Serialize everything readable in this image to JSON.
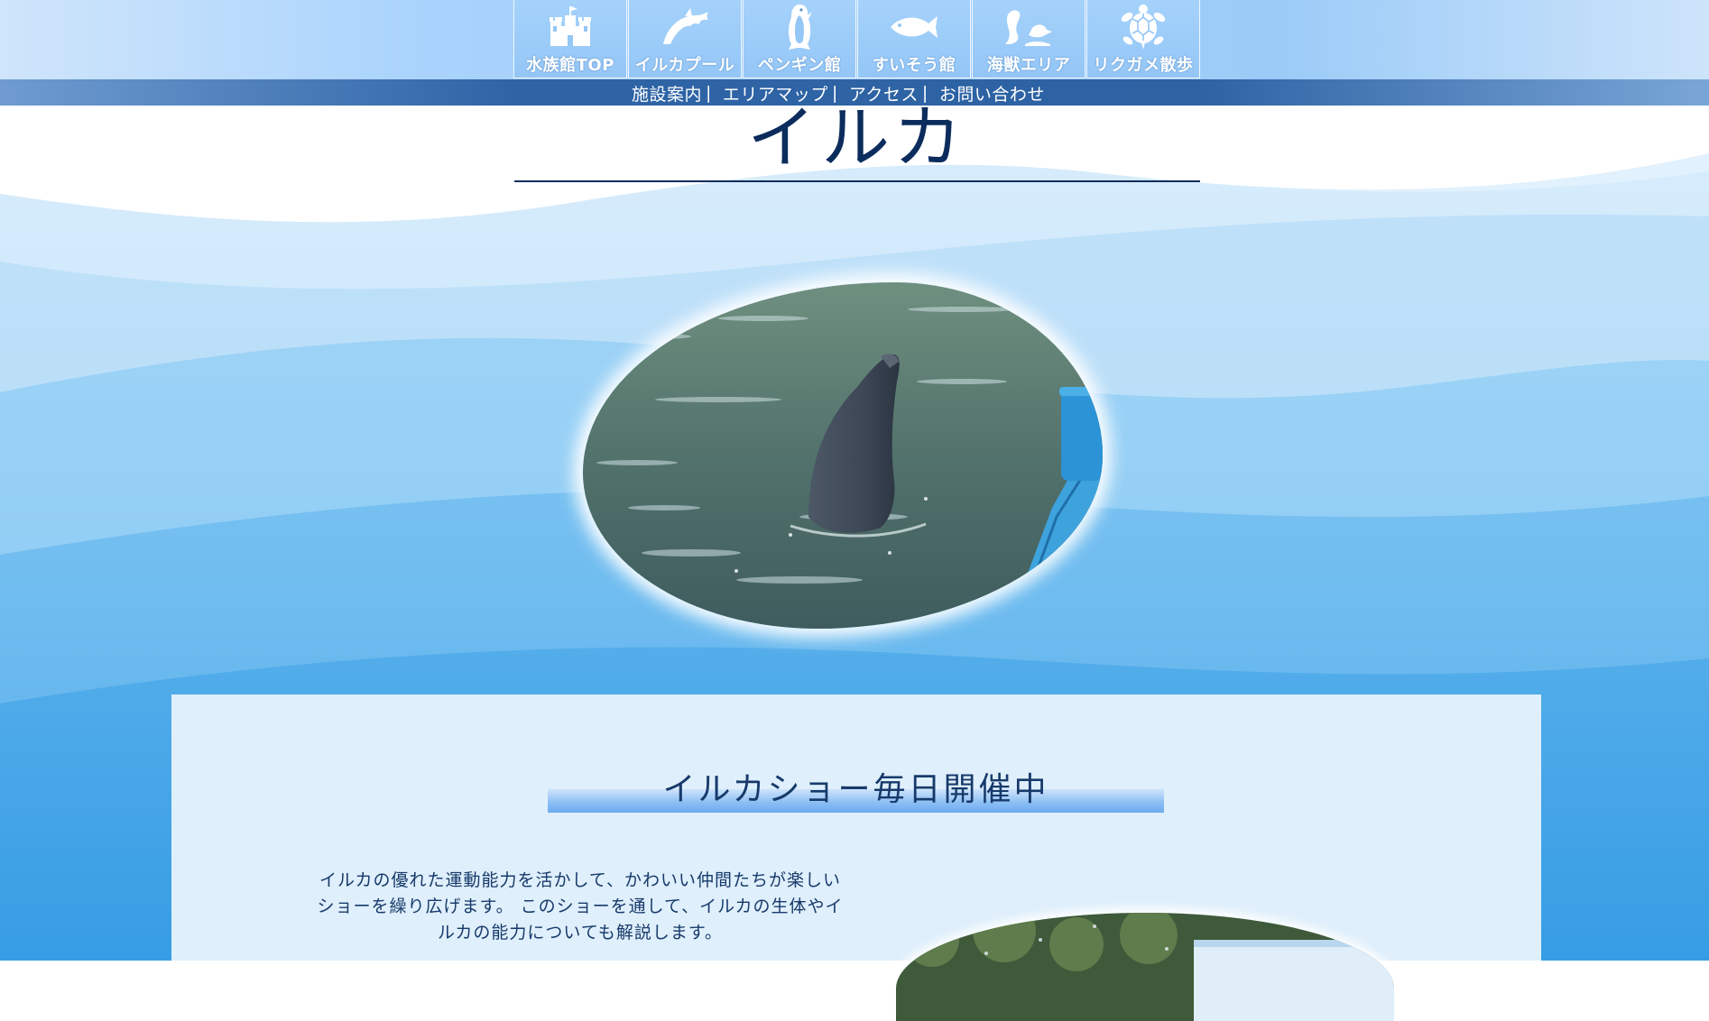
{
  "nav": {
    "items": [
      {
        "label": "水族館TOP",
        "icon": "castle-icon"
      },
      {
        "label": "イルカプール",
        "icon": "dolphin-icon"
      },
      {
        "label": "ペンギン館",
        "icon": "penguin-icon"
      },
      {
        "label": "すいそう館",
        "icon": "fish-icon"
      },
      {
        "label": "海獣エリア",
        "icon": "sea-lion-icon"
      },
      {
        "label": "リクガメ散歩",
        "icon": "turtle-icon"
      }
    ]
  },
  "subnav": {
    "links": [
      "施設案内",
      "エリアマップ",
      "アクセス",
      "お問い合わせ"
    ],
    "separator": "|"
  },
  "page": {
    "title": "イルカ"
  },
  "main": {
    "heading": "イルカショー毎日開催中",
    "description": "イルカの優れた運動能力を活かして、かわいい仲間たちが楽しいショーを繰り広げます。 このショーを通して、イルカの生体やイルカの能力についても解説します。"
  },
  "colors": {
    "title": "#0c2c5d",
    "nav_bg": "#9ccbf8",
    "subnav_bg": "#2d62a3",
    "panel_bg": "#dfeffb"
  }
}
